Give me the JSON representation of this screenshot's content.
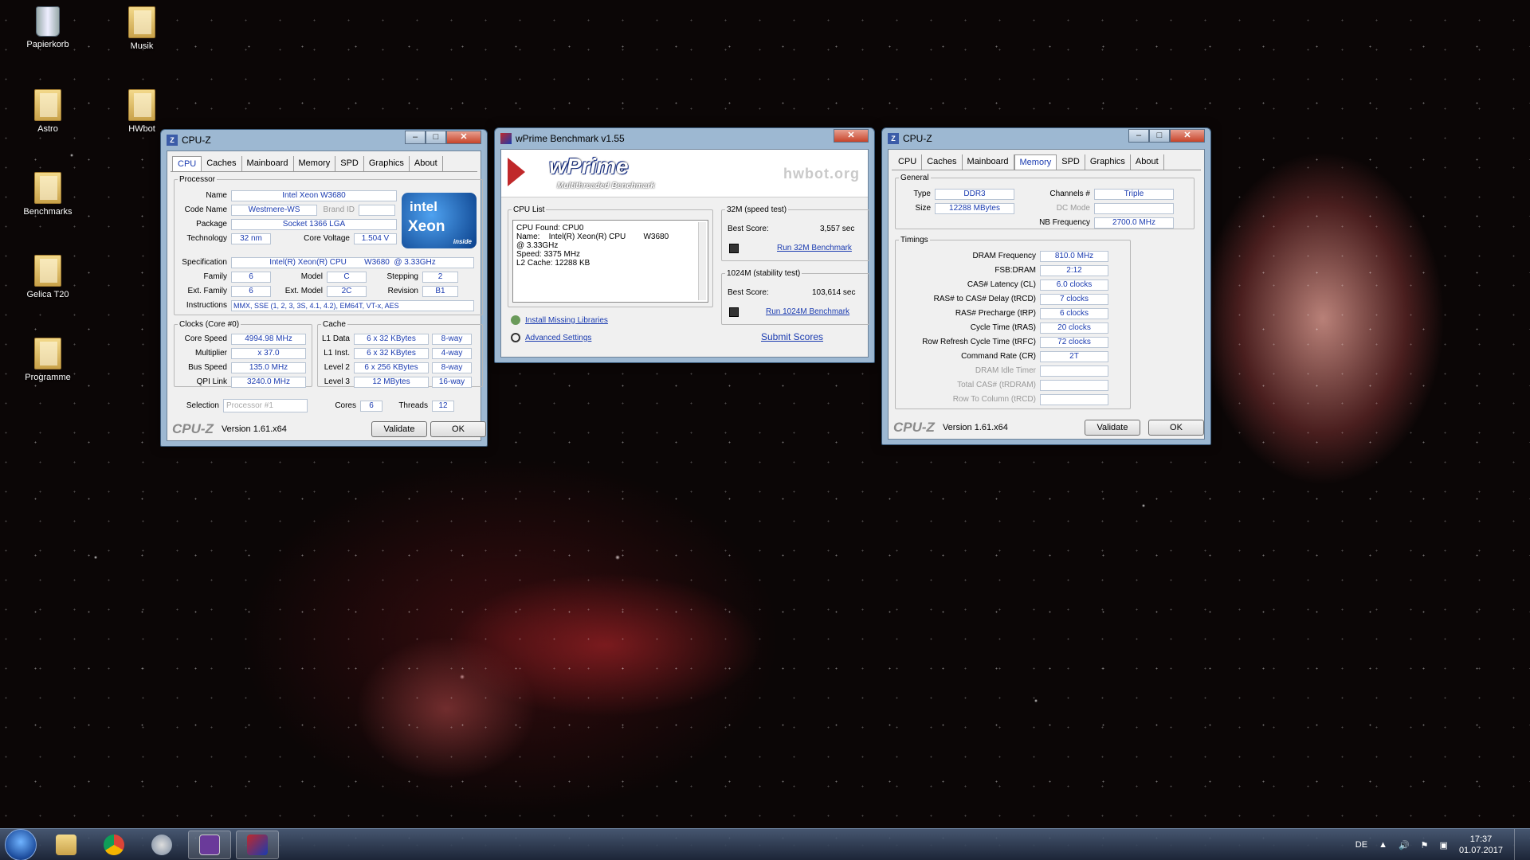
{
  "desktop": {
    "icons": [
      "Papierkorb",
      "Musik",
      "Astro",
      "HWbot",
      "Benchmarks",
      "Gelica T20",
      "Programme"
    ]
  },
  "cpuz1": {
    "title": "CPU-Z",
    "tabs": [
      "CPU",
      "Caches",
      "Mainboard",
      "Memory",
      "SPD",
      "Graphics",
      "About"
    ],
    "processor": {
      "legend": "Processor",
      "name_l": "Name",
      "name": "Intel Xeon W3680",
      "code_l": "Code Name",
      "code": "Westmere-WS",
      "brand_l": "Brand ID",
      "package_l": "Package",
      "package": "Socket 1366 LGA",
      "tech_l": "Technology",
      "tech": "32 nm",
      "cv_l": "Core Voltage",
      "cv": "1.504 V",
      "spec_l": "Specification",
      "spec": "Intel(R) Xeon(R) CPU        W3680  @ 3.33GHz",
      "family_l": "Family",
      "family": "6",
      "model_l": "Model",
      "model": "C",
      "stepping_l": "Stepping",
      "stepping": "2",
      "extfam_l": "Ext. Family",
      "extfam": "6",
      "extmodel_l": "Ext. Model",
      "extmodel": "2C",
      "revision_l": "Revision",
      "revision": "B1",
      "instr_l": "Instructions",
      "instr": "MMX, SSE (1, 2, 3, 3S, 4.1, 4.2), EM64T, VT-x, AES"
    },
    "intel": {
      "t1": "intel",
      "t2": "Xeon",
      "t3": "inside"
    },
    "clocks": {
      "legend": "Clocks (Core #0)",
      "cs_l": "Core Speed",
      "cs": "4994.98 MHz",
      "mul_l": "Multiplier",
      "mul": "x 37.0",
      "bus_l": "Bus Speed",
      "bus": "135.0 MHz",
      "qpi_l": "QPI Link",
      "qpi": "3240.0 MHz"
    },
    "cache": {
      "legend": "Cache",
      "l1d_l": "L1 Data",
      "l1d": "6 x 32 KBytes",
      "l1d_w": "8-way",
      "l1i_l": "L1 Inst.",
      "l1i": "6 x 32 KBytes",
      "l1i_w": "4-way",
      "l2_l": "Level 2",
      "l2": "6 x 256 KBytes",
      "l2_w": "8-way",
      "l3_l": "Level 3",
      "l3": "12 MBytes",
      "l3_w": "16-way"
    },
    "selection_l": "Selection",
    "selection": "Processor #1",
    "cores_l": "Cores",
    "cores": "6",
    "threads_l": "Threads",
    "threads": "12",
    "logo": "CPU-Z",
    "version": "Version 1.61.x64",
    "validate": "Validate",
    "ok": "OK"
  },
  "wprime": {
    "title": "wPrime Benchmark v1.55",
    "logo": "wPrime",
    "subtitle": "Multithreaded Benchmark",
    "hwbot": "hwbot.org",
    "cpulist_legend": "CPU List",
    "cpulist": [
      "CPU Found: CPU0",
      "Name:    Intel(R) Xeon(R) CPU        W3680",
      "@ 3.33GHz",
      "Speed:   3375 MHz",
      "L2 Cache: 12288 KB"
    ],
    "install": "Install Missing Libraries",
    "advanced": "Advanced Settings",
    "t32_legend": "32M (speed test)",
    "t32_best_l": "Best Score:",
    "t32_best": "3,557 sec",
    "t32_run": "Run 32M Benchmark",
    "t1024_legend": "1024M (stability test)",
    "t1024_best_l": "Best Score:",
    "t1024_best": "103,614 sec",
    "t1024_run": "Run 1024M Benchmark",
    "submit": "Submit Scores"
  },
  "cpuz2": {
    "title": "CPU-Z",
    "tabs": [
      "CPU",
      "Caches",
      "Mainboard",
      "Memory",
      "SPD",
      "Graphics",
      "About"
    ],
    "general": {
      "legend": "General",
      "type_l": "Type",
      "type": "DDR3",
      "size_l": "Size",
      "size": "12288 MBytes",
      "ch_l": "Channels #",
      "ch": "Triple",
      "dc_l": "DC Mode",
      "nb_l": "NB Frequency",
      "nb": "2700.0 MHz"
    },
    "timings": {
      "legend": "Timings",
      "rows": [
        {
          "l": "DRAM Frequency",
          "v": "810.0 MHz"
        },
        {
          "l": "FSB:DRAM",
          "v": "2:12"
        },
        {
          "l": "CAS# Latency (CL)",
          "v": "6.0 clocks"
        },
        {
          "l": "RAS# to CAS# Delay (tRCD)",
          "v": "7 clocks"
        },
        {
          "l": "RAS# Precharge (tRP)",
          "v": "6 clocks"
        },
        {
          "l": "Cycle Time (tRAS)",
          "v": "20 clocks"
        },
        {
          "l": "Row Refresh Cycle Time (tRFC)",
          "v": "72 clocks"
        },
        {
          "l": "Command Rate (CR)",
          "v": "2T"
        },
        {
          "l": "DRAM Idle Timer",
          "v": ""
        },
        {
          "l": "Total CAS# (tRDRAM)",
          "v": ""
        },
        {
          "l": "Row To Column (tRCD)",
          "v": ""
        }
      ]
    },
    "logo": "CPU-Z",
    "version": "Version 1.61.x64",
    "validate": "Validate",
    "ok": "OK"
  },
  "taskbar": {
    "lang": "DE",
    "time": "17:37",
    "date": "01.07.2017"
  }
}
